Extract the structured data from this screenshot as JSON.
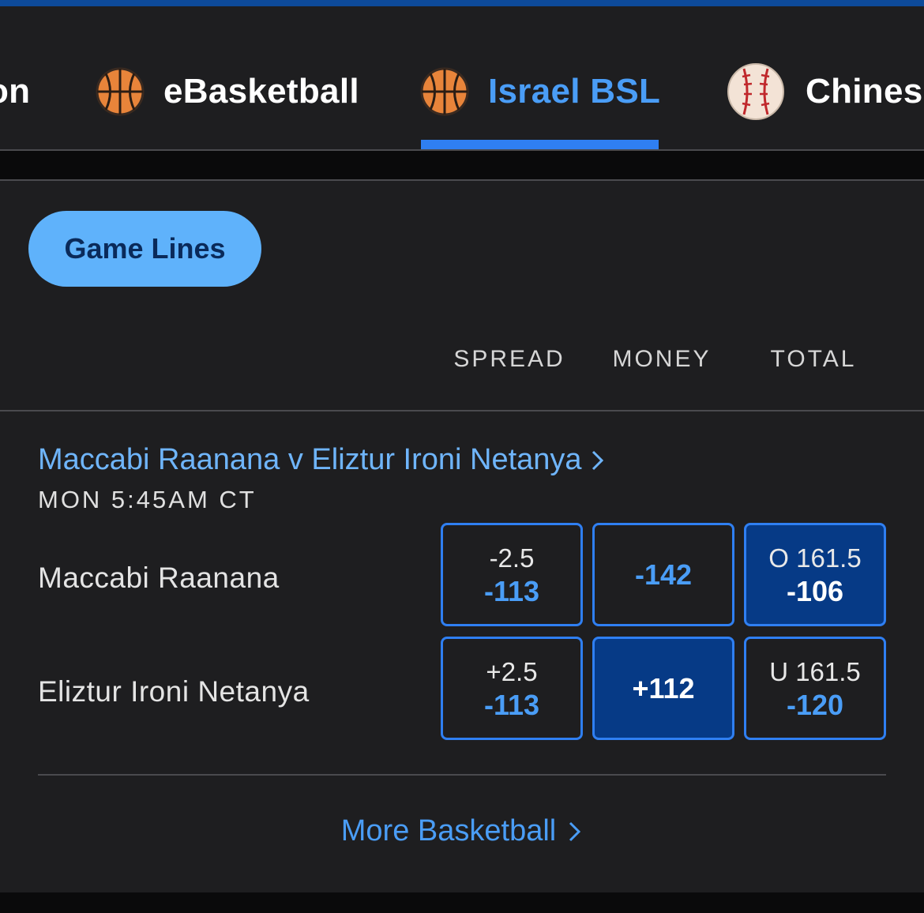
{
  "leagues": [
    {
      "label": "on",
      "icon": "basketball-icon"
    },
    {
      "label": "eBasketball",
      "icon": "basketball-icon"
    },
    {
      "label": "Israel BSL",
      "icon": "basketball-icon",
      "active": true
    },
    {
      "label": "Chines",
      "icon": "baseball-icon"
    }
  ],
  "filter": {
    "label": "Game Lines"
  },
  "columns": {
    "spread": "SPREAD",
    "money": "MONEY",
    "total": "TOTAL"
  },
  "event": {
    "title": "Maccabi Raanana v Eliztur Ironi Netanya",
    "time": "MON 5:45AM CT",
    "teams": [
      {
        "name": "Maccabi Raanana",
        "spread": {
          "line": "-2.5",
          "price": "-113"
        },
        "money": {
          "price": "-142"
        },
        "total": {
          "line": "O 161.5",
          "price": "-106",
          "selected": true
        }
      },
      {
        "name": "Eliztur Ironi Netanya",
        "spread": {
          "line": "+2.5",
          "price": "-113"
        },
        "money": {
          "price": "+112",
          "selected": true
        },
        "total": {
          "line": "U 161.5",
          "price": "-120"
        }
      }
    ]
  },
  "footer": {
    "more_label": "More Basketball"
  },
  "colors": {
    "accent": "#2f7ff2",
    "link": "#4a9df6",
    "selected_bg": "#063a86",
    "pill_bg": "#5fb2fb"
  }
}
